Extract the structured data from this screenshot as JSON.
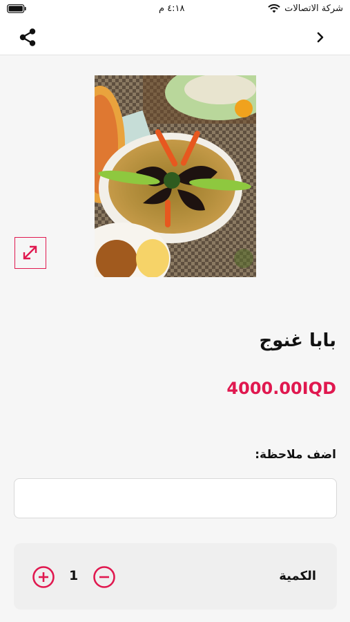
{
  "status_bar": {
    "carrier": "شركة الاتصالات",
    "time": "٤:١٨ م",
    "wifi_icon": "wifi-icon",
    "battery_icon": "battery-icon"
  },
  "nav": {
    "share_icon": "share-icon",
    "back_icon": "chevron-right-icon"
  },
  "product": {
    "image_alt": "food photo",
    "expand_icon": "expand-icon",
    "name": "بابا غنوج",
    "price": "4000.00IQD"
  },
  "note": {
    "label": "اضف ملاحظة:",
    "value": "",
    "placeholder": ""
  },
  "quantity": {
    "label": "الكمية",
    "value": "1",
    "plus_icon": "plus-circle-icon",
    "minus_icon": "minus-circle-icon"
  },
  "colors": {
    "accent": "#e0184f",
    "background": "#f6f6f6"
  }
}
